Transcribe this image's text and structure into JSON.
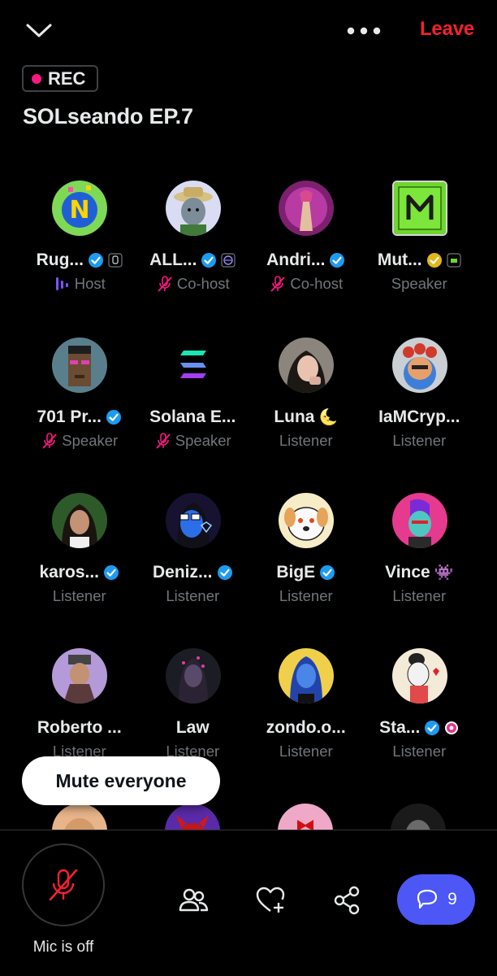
{
  "header": {
    "leave_label": "Leave",
    "rec_label": "REC",
    "space_title": "SOLseando EP.7"
  },
  "participants": [
    {
      "name": "Rug...",
      "role": "Host"
    },
    {
      "name": "ALL...",
      "role": "Co-host"
    },
    {
      "name": "Andri...",
      "role": "Co-host"
    },
    {
      "name": "Mut...",
      "role": "Speaker"
    },
    {
      "name": "701 Pr...",
      "role": "Speaker"
    },
    {
      "name": "Solana E...",
      "role": "Speaker"
    },
    {
      "name": "Luna",
      "role": "Listener",
      "emoji": "🌜"
    },
    {
      "name": "IaMCryp...",
      "role": "Listener"
    },
    {
      "name": "karos...",
      "role": "Listener"
    },
    {
      "name": "Deniz...",
      "role": "Listener"
    },
    {
      "name": "BigE",
      "role": "Listener"
    },
    {
      "name": "Vince",
      "role": "Listener",
      "emoji": "👾"
    },
    {
      "name": "Roberto ...",
      "role": "Listener"
    },
    {
      "name": "Law",
      "role": "Listener"
    },
    {
      "name": "zondo.o...",
      "role": "Listener"
    },
    {
      "name": "Sta...",
      "role": "Listener"
    }
  ],
  "mute_everyone_label": "Mute everyone",
  "bottom": {
    "mic_label": "Mic is off",
    "chat_count": "9"
  },
  "colors": {
    "leave": "#f4212e",
    "rec_dot": "#f91880",
    "verified_blue": "#1d9bf0",
    "verified_gold": "#e2b719",
    "chat_button": "#4c57f5",
    "muted_icon": "#f91880"
  },
  "icons": {
    "collapse": "chevron-down-icon",
    "more": "more-dots-icon",
    "mic_off": "mic-off-icon",
    "people": "people-icon",
    "heart": "heart-plus-icon",
    "share": "share-icon",
    "chat": "chat-bubble-icon"
  }
}
